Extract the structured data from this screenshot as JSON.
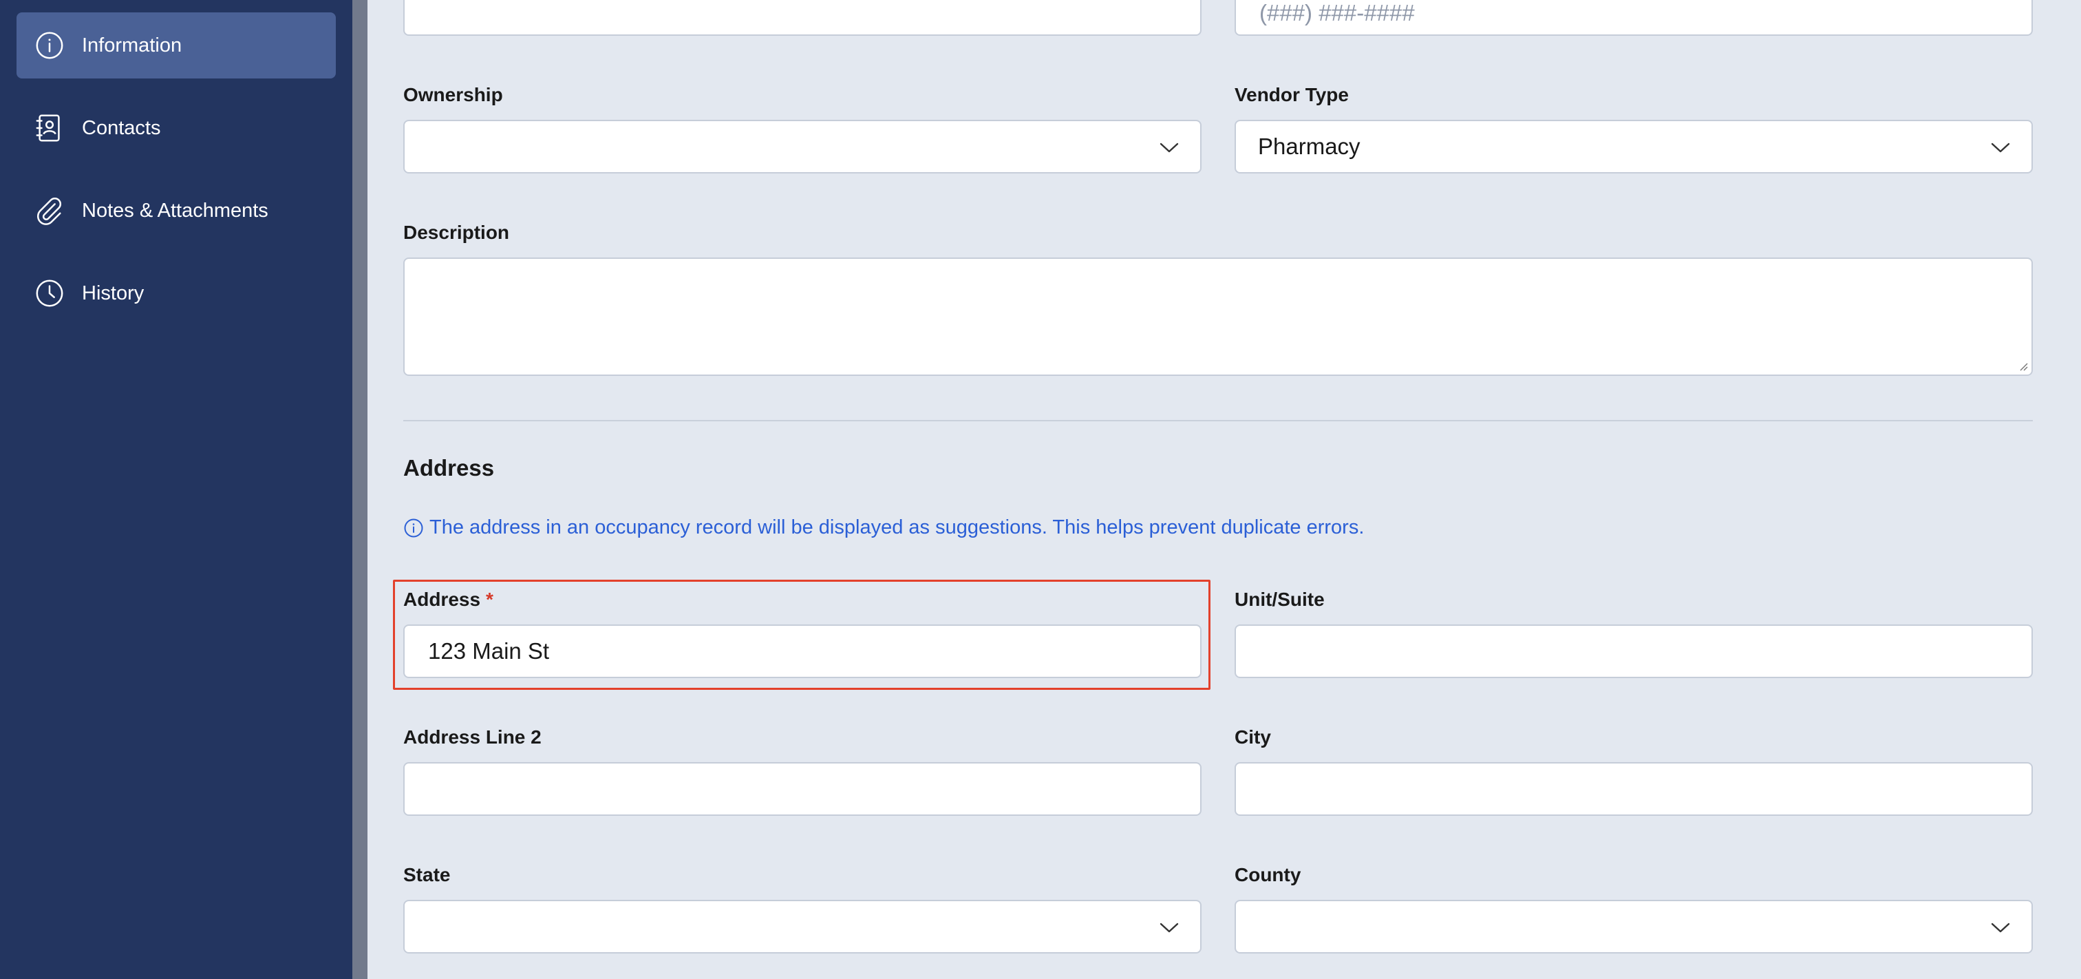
{
  "sidebar": {
    "items": [
      {
        "label": "Information",
        "icon": "info-circle-icon",
        "active": true
      },
      {
        "label": "Contacts",
        "icon": "contact-book-icon",
        "active": false
      },
      {
        "label": "Notes & Attachments",
        "icon": "paperclip-icon",
        "active": false
      },
      {
        "label": "History",
        "icon": "clock-icon",
        "active": false
      }
    ]
  },
  "form": {
    "phone": {
      "placeholder": "(###) ###-####",
      "value": ""
    },
    "ownership": {
      "label": "Ownership",
      "value": ""
    },
    "vendor_type": {
      "label": "Vendor Type",
      "value": "Pharmacy"
    },
    "description": {
      "label": "Description",
      "value": ""
    }
  },
  "address_section": {
    "title": "Address",
    "note": "The address in an occupancy record will be displayed as suggestions. This helps prevent duplicate errors.",
    "address": {
      "label": "Address",
      "required_mark": "*",
      "value": "123 Main St"
    },
    "unit_suite": {
      "label": "Unit/Suite",
      "value": ""
    },
    "address_line2": {
      "label": "Address Line 2",
      "value": ""
    },
    "city": {
      "label": "City",
      "value": ""
    },
    "state": {
      "label": "State",
      "value": ""
    },
    "county": {
      "label": "County",
      "value": ""
    }
  },
  "colors": {
    "sidebar_bg": "#233560",
    "sidebar_active": "#4a6196",
    "main_bg": "#e3e8f0",
    "info_blue": "#2b5fd6",
    "required_red": "#d63a2a",
    "highlight_red": "#e3412c"
  }
}
